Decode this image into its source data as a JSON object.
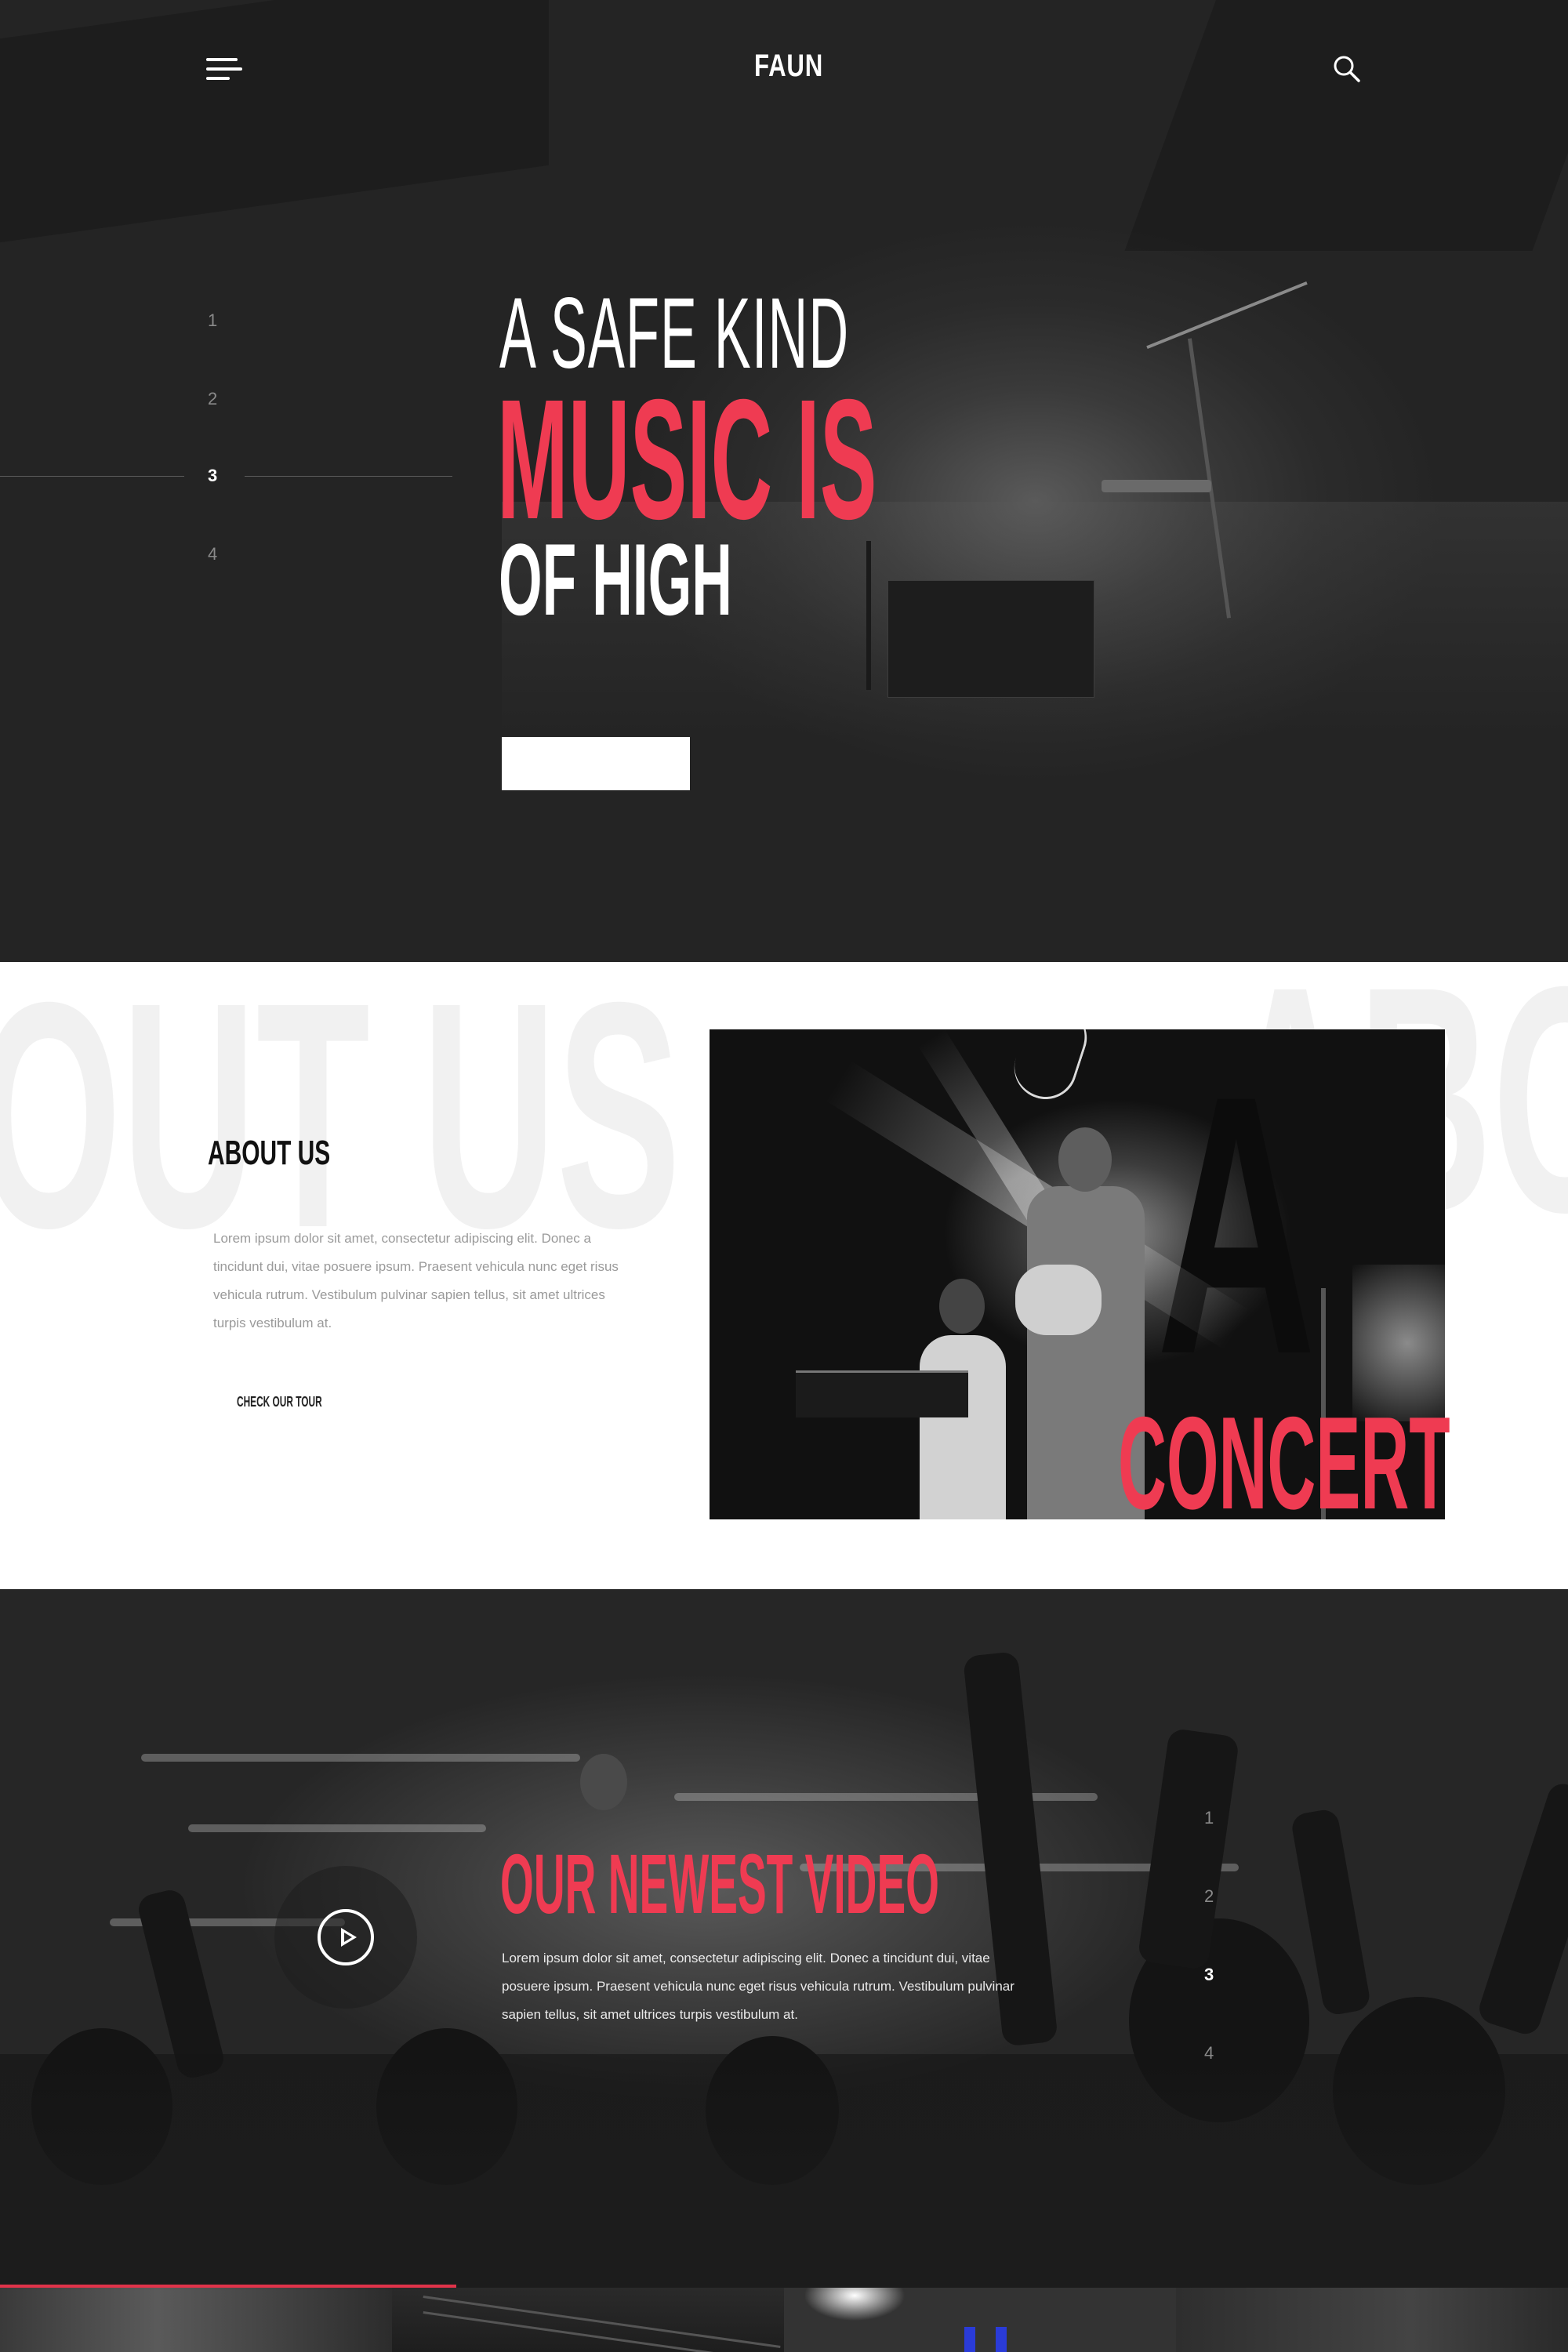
{
  "header": {
    "logo": "FAUN",
    "menu_icon": "hamburger-menu-icon",
    "search_icon": "search-icon"
  },
  "hero": {
    "line1": "A SAFE KIND",
    "line2": "MUSIC IS",
    "line3": "OF HIGH",
    "slides": [
      "1",
      "2",
      "3",
      "4"
    ],
    "active_slide": "3",
    "button_label": ""
  },
  "about": {
    "background_word_left": "OUT US",
    "background_word_right": "ABO",
    "title": "ABOUT US",
    "text": "Lorem ipsum dolor sit amet, consectetur adipiscing elit. Donec a tincidunt dui, vitae posuere ipsum. Praesent vehicula nunc eget risus vehicula rutrum. Vestibulum pulvinar sapien tellus, sit amet ultrices turpis vestibulum at.",
    "link_label": "CHECK OUR TOUR",
    "photo_caption": "CONCERT"
  },
  "video": {
    "title": "OUR NEWEST VIDEO",
    "text": "Lorem ipsum dolor sit amet, consectetur adipiscing elit. Donec a tincidunt dui, vitae posuere ipsum. Praesent vehicula nunc eget risus vehicula rutrum. Vestibulum pulvinar sapien tellus, sit amet ultrices turpis vestibulum at.",
    "play_icon": "play-icon",
    "slides": [
      "1",
      "2",
      "3",
      "4"
    ],
    "active_slide": "3"
  },
  "colors": {
    "accent": "#ef3b52",
    "dark_background": "#262626",
    "white": "#ffffff"
  }
}
